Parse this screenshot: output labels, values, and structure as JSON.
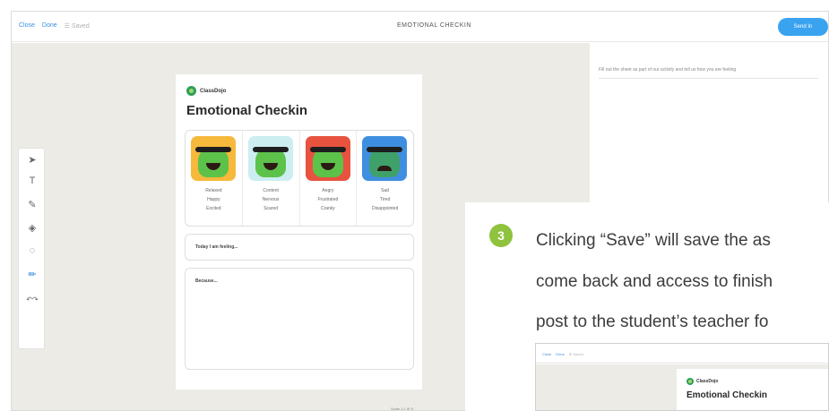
{
  "app": {
    "toolbar_links": [
      "Close",
      "Done"
    ],
    "toolbar_saved": "☰ Saved",
    "document_title": "EMOTIONAL CHECKIN",
    "send_button": "Send In",
    "instruction": "Fill out the sheet as part of our activity and tell us how you are feeling"
  },
  "tools": [
    {
      "icon": "pointer-icon",
      "glyph": "➤"
    },
    {
      "icon": "text-tool-icon",
      "glyph": "T"
    },
    {
      "icon": "pen-icon",
      "glyph": "✎"
    },
    {
      "icon": "eraser-icon",
      "glyph": "◈"
    },
    {
      "icon": "shape-icon",
      "glyph": "◌"
    },
    {
      "icon": "color-picker-icon",
      "glyph": "✏"
    },
    {
      "icon": "undo-redo-icon",
      "glyph": "↶↷"
    }
  ],
  "worksheet": {
    "brand": "ClassDojo",
    "title": "Emotional Checkin",
    "emotions": [
      {
        "name": "happy",
        "lines": [
          "Relaxed",
          "Happy",
          "Excited"
        ]
      },
      {
        "name": "content",
        "lines": [
          "Content",
          "Nervous",
          "Scared"
        ]
      },
      {
        "name": "angry",
        "lines": [
          "Angry",
          "Frustrated",
          "Cranky"
        ]
      },
      {
        "name": "sad",
        "lines": [
          "Sad",
          "Tired",
          "Disappointed"
        ]
      }
    ],
    "feeling_prompt": "Today I am feeling...",
    "because_prompt": "Because..."
  },
  "footer_tiny": "Scale 1:1 ⊕ ⊖",
  "overlay": {
    "step": "3",
    "lines": [
      "Clicking “Save” will save the as",
      "come back and access to finish",
      "post to the student’s teacher fo"
    ],
    "thumb": {
      "links": [
        "Close",
        "Done"
      ],
      "saved": "☰ Saved",
      "brand": "ClassDojo",
      "title": "Emotional Checkin"
    }
  },
  "colors": {
    "accent_blue": "#3aa3f0",
    "step_green": "#8fc23d",
    "canvas_bg": "#ecebe6"
  }
}
